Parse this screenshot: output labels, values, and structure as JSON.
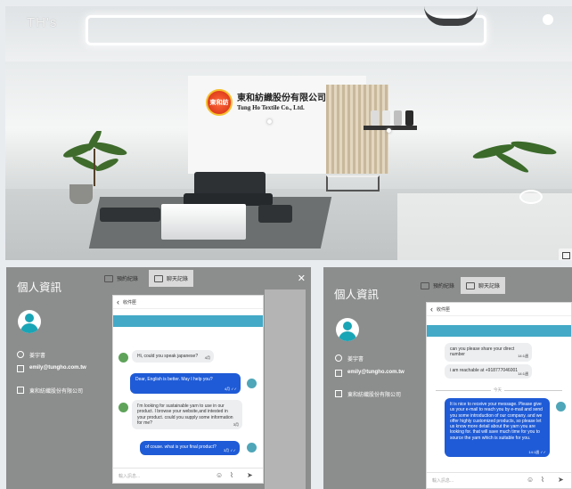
{
  "app": {
    "brand": "TH's"
  },
  "showroom": {
    "company_zh": "東和紡織股份有限公司",
    "company_en": "Tung Ho Textile Co., Ltd.",
    "logo_text": "東和紡"
  },
  "left_panel": {
    "title": "個人資訊",
    "name": "姜宇書",
    "email": "emily@tungho.com.tw",
    "company": "東和紡織股份有限公司",
    "tabs": {
      "record": "預約紀錄",
      "chat": "聊天記錄"
    },
    "close": "✕",
    "chat_header": "收件匣",
    "messages": [
      {
        "side": "in",
        "text": "Hi, could you speak japanese?",
        "time": "4月"
      },
      {
        "side": "out",
        "text": "Dear, English is better. May I help you?",
        "time": "4月 ✓✓"
      },
      {
        "side": "in",
        "text": "I'm looking for sustainable yarn to use in our product. I browse your website,and intested in your product. could you supply some information for me?",
        "time": "3月"
      },
      {
        "side": "out",
        "text": "of couse. what is your final product?",
        "time": "3月 ✓✓"
      }
    ],
    "composer_placeholder": "輸入訊息..."
  },
  "right_panel": {
    "title": "個人資訊",
    "name": "姜宇書",
    "email": "emily@tungho.com.tw",
    "company": "東和紡織股份有限公司",
    "tabs": {
      "record": "預約紀錄",
      "chat": "聊天記錄"
    },
    "chat_header": "收件匣",
    "messages": [
      {
        "side": "in",
        "text": "can you please share your direct number",
        "time": "14:1週"
      },
      {
        "side": "in",
        "text": "i am reachable at +918777046001",
        "time": "14:1週"
      }
    ],
    "divider_label": "今天",
    "long_message": "It is nice to receive your message. Please give us your e-mail to reach you by e-mail and send you some introduction of our company. and we offer highly customized products, so please let us know more detail about the yarn you are looking for. that will save much time for you to source the yarn which is suitable for you.",
    "long_time": "14:1週 ✓✓",
    "composer_placeholder": "輸入訊息..."
  },
  "colors": {
    "accent_blue": "#1f5bd6",
    "teal": "#43a9c7",
    "panel_gray": "#8c8d8d"
  },
  "icons": [
    "user-icon",
    "email-icon",
    "briefcase-icon",
    "calendar-icon",
    "chat-icon",
    "back-chevron-icon",
    "emoji-icon",
    "attach-icon",
    "send-icon",
    "map-icon",
    "close-icon"
  ]
}
